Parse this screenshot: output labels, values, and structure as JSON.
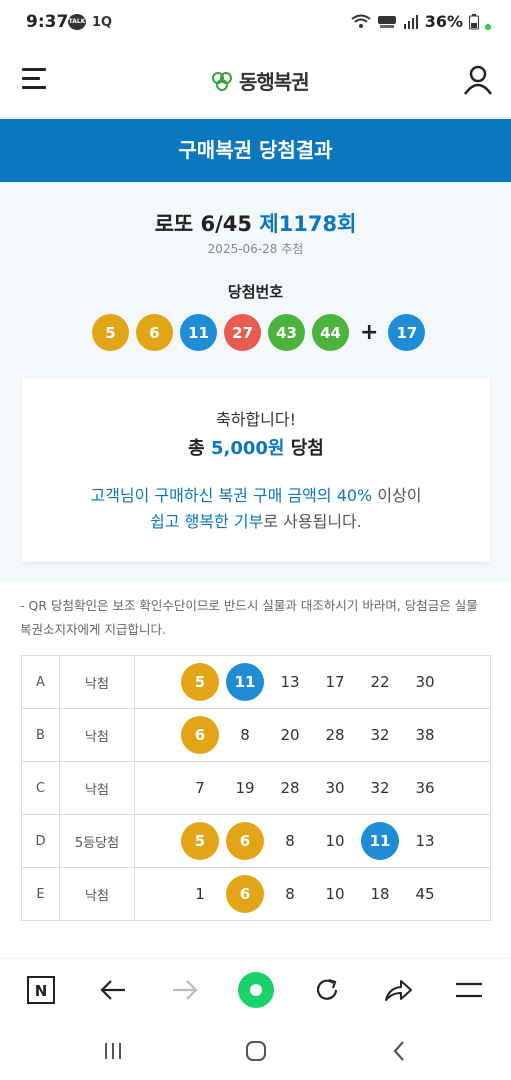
{
  "status_bar": {
    "time": "9:37",
    "left_icons": [
      "talk-icon",
      "1q-icon"
    ],
    "talk_label": "TALK",
    "q_label": "1Q",
    "right_icons": [
      "wifi-icon",
      "hd-voice-icon",
      "signal-icon"
    ],
    "battery": "36%"
  },
  "header": {
    "logo_text": "동행복권",
    "menu_icon": "hamburger-icon",
    "user_icon": "user-icon"
  },
  "banner": {
    "title": "구매복권 당첨결과"
  },
  "draw": {
    "game": "로또 6/45",
    "round": "제1178회",
    "date": "2025-06-28 추첨",
    "win_label": "당첨번호",
    "numbers": [
      {
        "n": "5",
        "color": "#e2a517"
      },
      {
        "n": "6",
        "color": "#e2a517"
      },
      {
        "n": "11",
        "color": "#1f8dd6"
      },
      {
        "n": "27",
        "color": "#e85b50"
      },
      {
        "n": "43",
        "color": "#4cb43d"
      },
      {
        "n": "44",
        "color": "#4cb43d"
      }
    ],
    "plus": "+",
    "bonus": {
      "n": "17",
      "color": "#1f8dd6"
    }
  },
  "result_card": {
    "congrats": "축하합니다!",
    "prize_prefix": "총",
    "prize_amount": "5,000원",
    "prize_suffix": "당첨",
    "msg1_hl": "고객님이 구매하신 복권 구매 금액의 40%",
    "msg1_rest": "이상이",
    "msg2_hl": "쉽고 행복한 기부",
    "msg2_rest": "로 사용됩니다."
  },
  "notice": "- QR 당첨확인은 보조 확인수단이므로 반드시 실물과 대조하시기 바라며, 당첨금은 실물 복권소지자에게 지급합니다.",
  "ticket": [
    {
      "game": "A",
      "result": "낙첨",
      "nums": [
        {
          "n": "5",
          "hit": true,
          "color": "#e2a517"
        },
        {
          "n": "11",
          "hit": true,
          "color": "#1f8dd6"
        },
        {
          "n": "13",
          "hit": false
        },
        {
          "n": "17",
          "hit": false
        },
        {
          "n": "22",
          "hit": false
        },
        {
          "n": "30",
          "hit": false
        }
      ]
    },
    {
      "game": "B",
      "result": "낙첨",
      "nums": [
        {
          "n": "6",
          "hit": true,
          "color": "#e2a517"
        },
        {
          "n": "8",
          "hit": false
        },
        {
          "n": "20",
          "hit": false
        },
        {
          "n": "28",
          "hit": false
        },
        {
          "n": "32",
          "hit": false
        },
        {
          "n": "38",
          "hit": false
        }
      ]
    },
    {
      "game": "C",
      "result": "낙첨",
      "nums": [
        {
          "n": "7",
          "hit": false
        },
        {
          "n": "19",
          "hit": false
        },
        {
          "n": "28",
          "hit": false
        },
        {
          "n": "30",
          "hit": false
        },
        {
          "n": "32",
          "hit": false
        },
        {
          "n": "36",
          "hit": false
        }
      ]
    },
    {
      "game": "D",
      "result": "5등당첨",
      "nums": [
        {
          "n": "5",
          "hit": true,
          "color": "#e2a517"
        },
        {
          "n": "6",
          "hit": true,
          "color": "#e2a517"
        },
        {
          "n": "8",
          "hit": false
        },
        {
          "n": "10",
          "hit": false
        },
        {
          "n": "11",
          "hit": true,
          "color": "#1f8dd6"
        },
        {
          "n": "13",
          "hit": false
        }
      ]
    },
    {
      "game": "E",
      "result": "낙첨",
      "nums": [
        {
          "n": "1",
          "hit": false
        },
        {
          "n": "6",
          "hit": true,
          "color": "#e2a517"
        },
        {
          "n": "8",
          "hit": false
        },
        {
          "n": "10",
          "hit": false
        },
        {
          "n": "18",
          "hit": false
        },
        {
          "n": "45",
          "hit": false
        }
      ]
    }
  ],
  "browser_bar": {
    "buttons": [
      "naver-icon",
      "back-arrow-icon",
      "forward-arrow-icon",
      "home-green-icon",
      "refresh-icon",
      "share-icon",
      "menu-icon"
    ],
    "naver_label": "N"
  },
  "system_nav": [
    "recents-icon",
    "home-icon",
    "back-icon"
  ]
}
